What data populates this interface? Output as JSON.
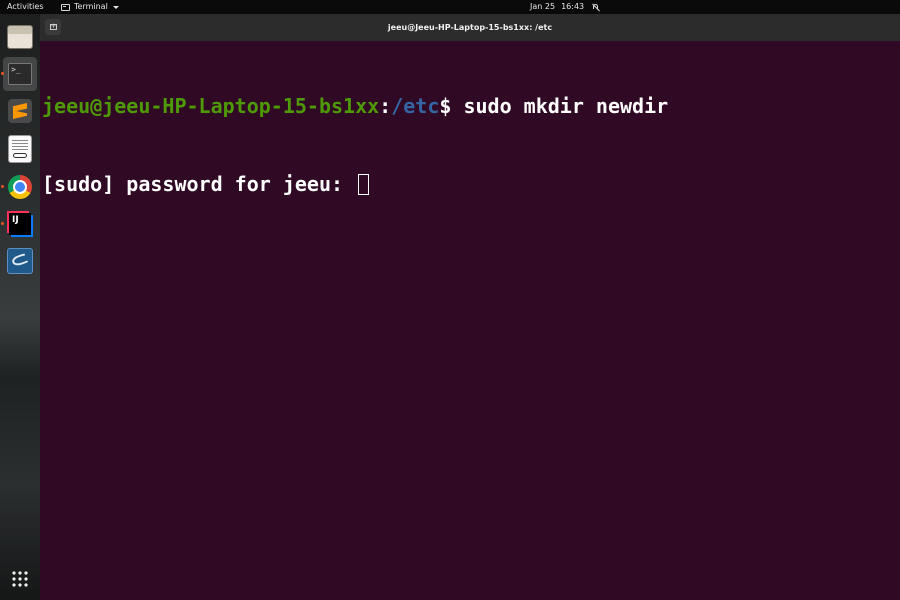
{
  "topbar": {
    "activities_label": "Activities",
    "app_name": "Terminal",
    "app_icon": "terminal-icon",
    "date": "Jan 25",
    "time": "16:43",
    "notification_icon": "bell-muted-icon"
  },
  "dock": {
    "items": [
      {
        "name": "Files",
        "icon": "files-icon",
        "running": false
      },
      {
        "name": "Terminal",
        "icon": "terminal-icon",
        "running": true,
        "active": true
      },
      {
        "name": "Sublime Text",
        "icon": "sublime-text-icon",
        "running": false
      },
      {
        "name": "Document Viewer",
        "icon": "document-viewer-icon",
        "running": false
      },
      {
        "name": "Google Chrome",
        "icon": "chrome-icon",
        "running": true
      },
      {
        "name": "IntelliJ IDEA",
        "icon": "intellij-icon",
        "running": true
      },
      {
        "name": "MySQL Workbench",
        "icon": "mysql-workbench-icon",
        "running": false
      }
    ],
    "show_apps_icon": "app-grid-icon"
  },
  "window": {
    "title": "jeeu@Jeeu-HP-Laptop-15-bs1xx: /etc",
    "background": "#300a24"
  },
  "terminal": {
    "prompt_user_host": "jeeu@jeeu-HP-Laptop-15-bs1xx",
    "prompt_sep": ":",
    "prompt_path": "/etc",
    "prompt_symbol": "$ ",
    "command": "sudo mkdir newdir",
    "password_prompt": "[sudo] password for jeeu: ",
    "colors": {
      "user_host": "#4e9a06",
      "path": "#3465a4",
      "text": "#ffffff"
    }
  }
}
